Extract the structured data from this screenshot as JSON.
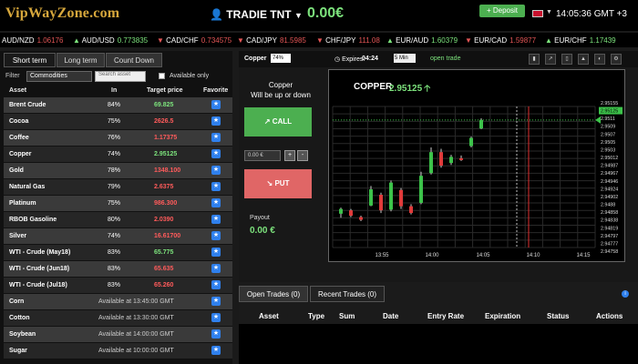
{
  "header": {
    "logo": "VipWayZone.com",
    "user_name": "TRADIE TNT",
    "balance": "0.00€",
    "deposit_label": "+ Deposit",
    "time": "14:05:36 GMT +3"
  },
  "ticker": [
    {
      "pair": "AUD/NZD",
      "value": "1.06176",
      "dir": "down"
    },
    {
      "pair": "AUD/USD",
      "value": "0.773835",
      "dir": "up"
    },
    {
      "pair": "CAD/CHF",
      "value": "0.734575",
      "dir": "down"
    },
    {
      "pair": "CAD/JPY",
      "value": "81.5985",
      "dir": "down"
    },
    {
      "pair": "CHF/JPY",
      "value": "111.08",
      "dir": "down"
    },
    {
      "pair": "EUR/AUD",
      "value": "1.60379",
      "dir": "up"
    },
    {
      "pair": "EUR/CAD",
      "value": "1.59877",
      "dir": "down"
    },
    {
      "pair": "EUR/CHF",
      "value": "1.17439",
      "dir": "up"
    }
  ],
  "tabs": [
    "Short term",
    "Long term",
    "Count Down"
  ],
  "filter": {
    "label": "Filter",
    "category": "Commodities",
    "search_placeholder": "Search asset",
    "available_only": "Available only"
  },
  "table": {
    "headers": [
      "Asset",
      "In",
      "Target price",
      "Favorite"
    ],
    "rows": [
      {
        "asset": "Brent Crude",
        "pct": "84%",
        "price": "69.825",
        "dir": "up"
      },
      {
        "asset": "Cocoa",
        "pct": "75%",
        "price": "2626.5",
        "dir": "down"
      },
      {
        "asset": "Coffee",
        "pct": "76%",
        "price": "1.17375",
        "dir": "down"
      },
      {
        "asset": "Copper",
        "pct": "74%",
        "price": "2.95125",
        "dir": "up"
      },
      {
        "asset": "Gold",
        "pct": "78%",
        "price": "1348.100",
        "dir": "down"
      },
      {
        "asset": "Natural Gas",
        "pct": "79%",
        "price": "2.6375",
        "dir": "down"
      },
      {
        "asset": "Platinum",
        "pct": "75%",
        "price": "986.300",
        "dir": "down"
      },
      {
        "asset": "RBOB Gasoline",
        "pct": "80%",
        "price": "2.0390",
        "dir": "down"
      },
      {
        "asset": "Silver",
        "pct": "74%",
        "price": "16.61700",
        "dir": "down"
      },
      {
        "asset": "WTI - Crude (May18)",
        "pct": "83%",
        "price": "65.775",
        "dir": "up"
      },
      {
        "asset": "WTI - Crude (Jun18)",
        "pct": "83%",
        "price": "65.635",
        "dir": "down"
      },
      {
        "asset": "WTI - Crude (Jul18)",
        "pct": "83%",
        "price": "65.260",
        "dir": "down"
      }
    ],
    "unavailable": [
      {
        "asset": "Corn",
        "text": "Available at 13:45:00 GMT"
      },
      {
        "asset": "Cotton",
        "text": "Available at 13:30:00 GMT"
      },
      {
        "asset": "Soybean",
        "text": "Available at 14:00:00 GMT"
      },
      {
        "asset": "Sugar",
        "text": "Available at 10:00:00 GMT"
      }
    ]
  },
  "trade": {
    "asset": "Copper",
    "percent": "74%",
    "expires_label": "Expires:",
    "expires_time": "04:24",
    "expiry": "5 Min",
    "open_trade": "open trade",
    "prompt": "Will be up or down",
    "call_label": "CALL",
    "put_label": "PUT",
    "amount": "0.00 €",
    "payout_label": "Payout",
    "payout_value": "0.00 €"
  },
  "chart_data": {
    "type": "candlestick",
    "title": "COPPER",
    "current_price": "2.95125",
    "y_ticks": [
      "2.95155",
      "2.95125",
      "2.9511",
      "2.9509",
      "2.9507",
      "2.9505",
      "2.9503",
      "2.95012",
      "2.94987",
      "2.94967",
      "2.94946",
      "2.94924",
      "2.94902",
      "2.9488",
      "2.94858",
      "2.94838",
      "2.94819",
      "2.94797",
      "2.94777",
      "2.94758"
    ],
    "x_ticks": [
      "13:55",
      "14:00",
      "14:05",
      "14:10",
      "14:15"
    ],
    "candles": [
      {
        "o": 2.94848,
        "c": 2.94862,
        "h": 2.94866,
        "l": 2.94836
      },
      {
        "o": 2.94858,
        "c": 2.94842,
        "h": 2.94862,
        "l": 2.94838
      },
      {
        "o": 2.94838,
        "c": 2.9483,
        "h": 2.94842,
        "l": 2.94826
      },
      {
        "o": 2.94872,
        "c": 2.9492,
        "h": 2.9493,
        "l": 2.9487
      },
      {
        "o": 2.94904,
        "c": 2.94858,
        "h": 2.9491,
        "l": 2.9485
      },
      {
        "o": 2.9486,
        "c": 2.9494,
        "h": 2.94946,
        "l": 2.94855
      },
      {
        "o": 2.94918,
        "c": 2.9487,
        "h": 2.94924,
        "l": 2.94862
      },
      {
        "o": 2.9487,
        "c": 2.9485,
        "h": 2.94876,
        "l": 2.94846
      },
      {
        "o": 2.9488,
        "c": 2.9496,
        "h": 2.94972,
        "l": 2.94876
      },
      {
        "o": 2.94968,
        "c": 2.9503,
        "h": 2.95044,
        "l": 2.94964
      },
      {
        "o": 2.9503,
        "c": 2.9499,
        "h": 2.9504,
        "l": 2.94984
      },
      {
        "o": 2.94998,
        "c": 2.95016,
        "h": 2.95022,
        "l": 2.94992
      },
      {
        "o": 2.95012,
        "c": 2.95008,
        "h": 2.9502,
        "l": 2.95004
      },
      {
        "o": 2.95048,
        "c": 2.95072,
        "h": 2.95076,
        "l": 2.95044
      },
      {
        "o": 2.951,
        "c": 2.95125,
        "h": 2.9513,
        "l": 2.95098
      }
    ]
  },
  "bottom": {
    "tabs": [
      "Open Trades (0)",
      "Recent Trades (0)"
    ],
    "headers": [
      "Asset",
      "Type",
      "Sum",
      "Date",
      "Entry Rate",
      "Expiration",
      "Status",
      "Actions"
    ]
  }
}
